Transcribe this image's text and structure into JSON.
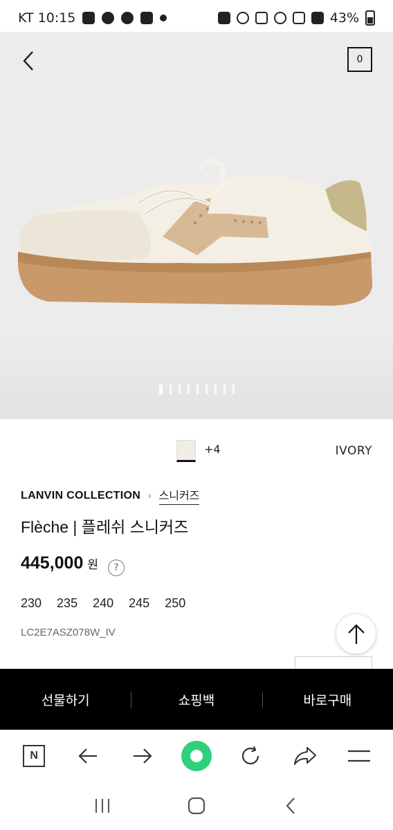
{
  "status_bar": {
    "carrier_time": "KT 10:15",
    "battery": "43%"
  },
  "header": {
    "cart_count": "0"
  },
  "gallery": {
    "image_count": 9,
    "active_index": 0
  },
  "product": {
    "color_more": "+4",
    "color_name": "IVORY",
    "brand": "LANVIN COLLECTION",
    "category": "스니커즈",
    "name": "Flèche | 플레쉬 스니커즈",
    "price": "445,000",
    "currency": "원",
    "sizes": [
      "230",
      "235",
      "240",
      "245",
      "250"
    ],
    "sku": "LC2E7ASZ078W_IV"
  },
  "actions": {
    "gift": "선물하기",
    "bag": "쇼핑백",
    "buy_now": "바로구매"
  },
  "icons": {
    "back": "chevron-left-icon",
    "cart": "cart-icon",
    "help": "question-icon",
    "top": "arrow-up-icon",
    "browser_home": "naver-n-icon",
    "browser_back": "arrow-left-icon",
    "browser_forward": "arrow-right-icon",
    "browser_green": "green-dot-icon",
    "browser_reload": "reload-icon",
    "browser_share": "share-icon",
    "browser_menu": "menu-icon"
  },
  "colors": {
    "action_bar": "#000000",
    "swatch_ivory": "#f1ede4",
    "browser_green": "#2fd07a"
  }
}
